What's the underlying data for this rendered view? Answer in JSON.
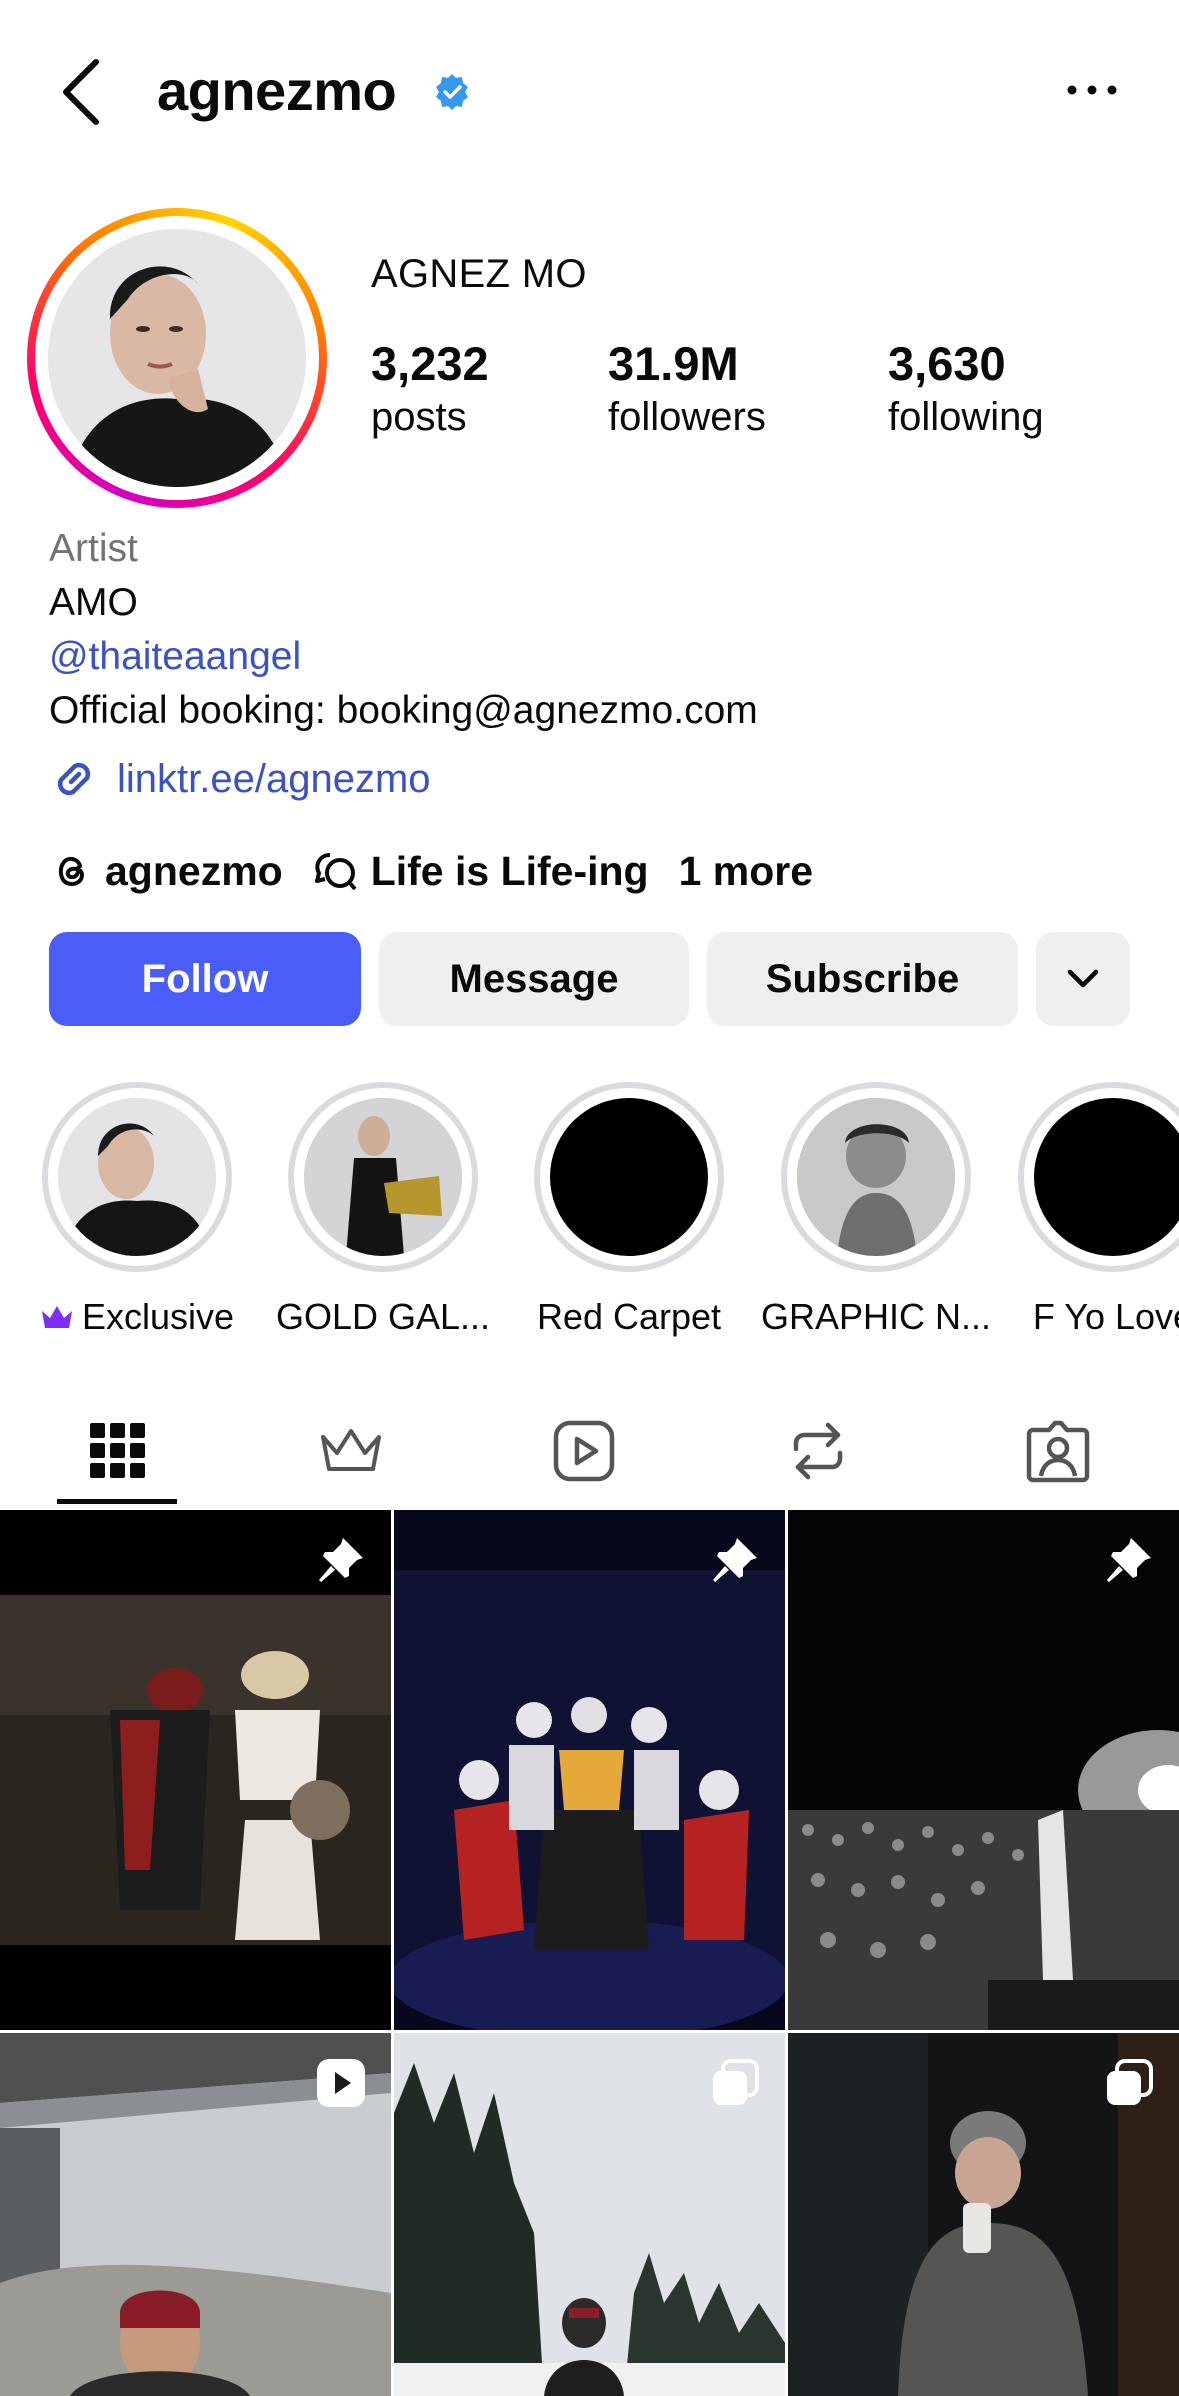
{
  "header": {
    "username": "agnezmo"
  },
  "profile": {
    "display_name": "AGNEZ MO",
    "stats": [
      {
        "value": "3,232",
        "label": "posts"
      },
      {
        "value": "31.9M",
        "label": "followers"
      },
      {
        "value": "3,630",
        "label": "following"
      }
    ]
  },
  "bio": {
    "category": "Artist",
    "lines": [
      "AMO"
    ],
    "mention": "@thaiteaangel",
    "booking": "Official booking: booking@agnezmo.com",
    "link": "linktr.ee/agnezmo"
  },
  "threads_row": {
    "threads_handle": "agnezmo",
    "channel": "Life is Life-ing",
    "more": "1 more"
  },
  "actions": {
    "follow": "Follow",
    "message": "Message",
    "subscribe": "Subscribe"
  },
  "highlights": [
    {
      "label": "Exclusive",
      "crown": true
    },
    {
      "label": "GOLD GAL..."
    },
    {
      "label": "Red Carpet"
    },
    {
      "label": "GRAPHIC N..."
    },
    {
      "label": "F Yo Love"
    }
  ],
  "tabs": [
    "grid-icon",
    "crown-icon",
    "reels-icon",
    "repost-icon",
    "tagged-icon"
  ],
  "grid": [
    {
      "badge": "pin-icon"
    },
    {
      "badge": "pin-icon"
    },
    {
      "badge": "pin-icon"
    },
    {
      "badge": "reel-icon"
    },
    {
      "badge": "carousel-icon"
    },
    {
      "badge": "carousel-icon"
    }
  ],
  "colors": {
    "follow_button": "#4a5df9",
    "link": "#3a52c4",
    "verified": "#3897f0",
    "secondary_button": "#efeff2"
  }
}
